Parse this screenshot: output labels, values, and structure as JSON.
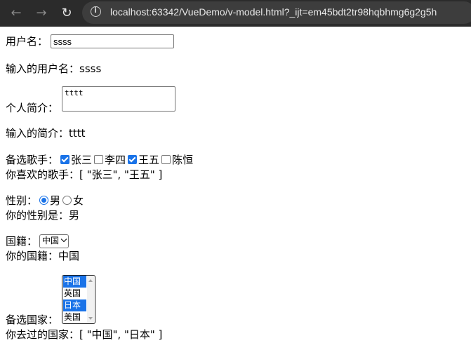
{
  "browser": {
    "url": "localhost:63342/VueDemo/v-model.html?_ijt=em45bdt2tr98hqbhmg6g2g5h"
  },
  "username": {
    "label": "用户名：",
    "value": "ssss",
    "echo_label": "输入的用户名：",
    "echo_value": "ssss"
  },
  "bio": {
    "label": "个人简介：",
    "value": "tttt",
    "echo_label": "输入的简介：",
    "echo_value": "tttt"
  },
  "singers": {
    "label": "备选歌手：",
    "options": [
      {
        "label": "张三",
        "checked": true
      },
      {
        "label": "李四",
        "checked": false
      },
      {
        "label": "王五",
        "checked": true
      },
      {
        "label": "陈恒",
        "checked": false
      }
    ],
    "echo_label": "你喜欢的歌手：",
    "echo_value": "[ \"张三\", \"王五\" ]"
  },
  "gender": {
    "label": "性别：",
    "options": [
      {
        "label": "男",
        "checked": true
      },
      {
        "label": "女",
        "checked": false
      }
    ],
    "echo_label": "你的性别是：",
    "echo_value": "男"
  },
  "nationality": {
    "label": "国籍：",
    "selected": "中国",
    "echo_label": "你的国籍：",
    "echo_value": "中国"
  },
  "countries": {
    "label": "备选国家：",
    "options": [
      {
        "label": "中国",
        "selected": true
      },
      {
        "label": "英国",
        "selected": false
      },
      {
        "label": "日本",
        "selected": true
      },
      {
        "label": "美国",
        "selected": false
      }
    ],
    "echo_label": "你去过的国家：",
    "echo_value": "[ \"中国\", \"日本\" ]"
  },
  "colors": {
    "accent": "#1a73e8",
    "toolbar_bg": "#2b2b2b"
  }
}
